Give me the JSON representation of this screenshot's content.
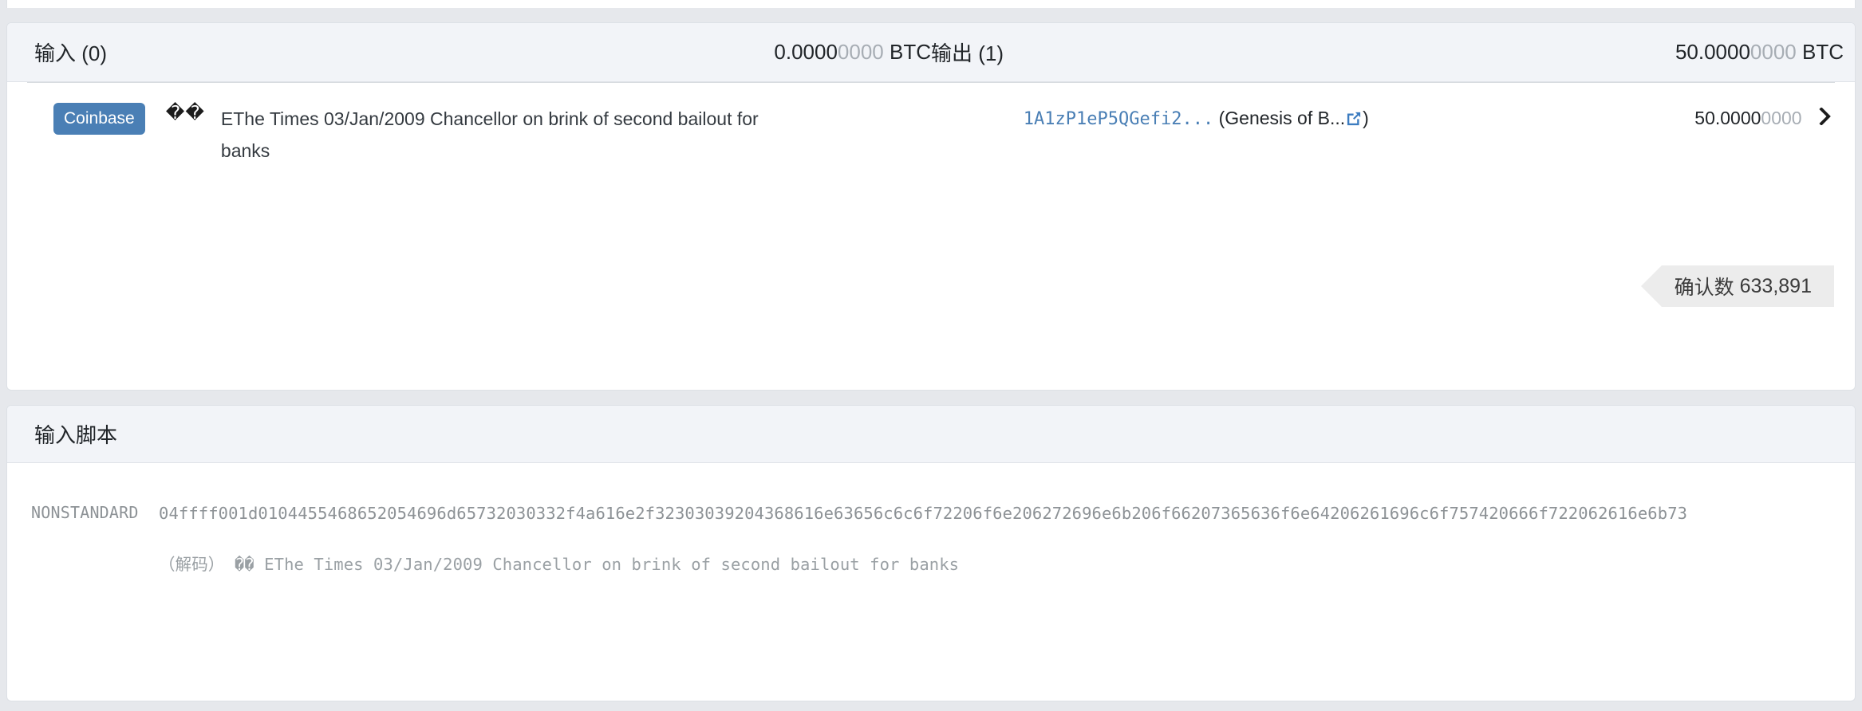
{
  "io_panel": {
    "inputs": {
      "title": "输入 (0)",
      "amount_bright": "0.0000",
      "amount_dim": "0000",
      "unit": "BTC"
    },
    "outputs": {
      "title": "输出 (1)",
      "amount_bright": "50.0000",
      "amount_dim": "0000",
      "unit": "BTC"
    },
    "entry": {
      "badge": "Coinbase",
      "replacement_chars": "��",
      "coinbase_text": "EThe Times 03/Jan/2009 Chancellor on brink of second bailout for banks",
      "address": "1A1zP1eP5QGefi2...",
      "label_open": "(Genesis of B...",
      "label_close": ")",
      "external_link_icon": "external-link-icon",
      "value_bright": "50.0000",
      "value_dim": "0000",
      "chevron_icon": "chevron-right-icon"
    },
    "confirmations": {
      "label": "确认数",
      "count": "633,891"
    }
  },
  "script_panel": {
    "title": "输入脚本",
    "script_type": "NONSTANDARD",
    "hex": "04ffff001d0104455468652054696d65732030332f4a616e2f32303039204368616e63656c6c6f72206f6e206272696e6b206f66207365636f6e64206261696c6f757420666f722062616e6b73",
    "decoded_prefix": "（解码）",
    "decoded_value": "�� EThe Times 03/Jan/2009 Chancellor on brink of second bailout for banks"
  },
  "colors": {
    "page_bg": "#e6e8ec",
    "card_bg": "#ffffff",
    "header_bg": "#f2f4f8",
    "accent_blue": "#4a7fb5",
    "muted_text": "#8d9296",
    "ribbon_bg": "#ececec"
  }
}
